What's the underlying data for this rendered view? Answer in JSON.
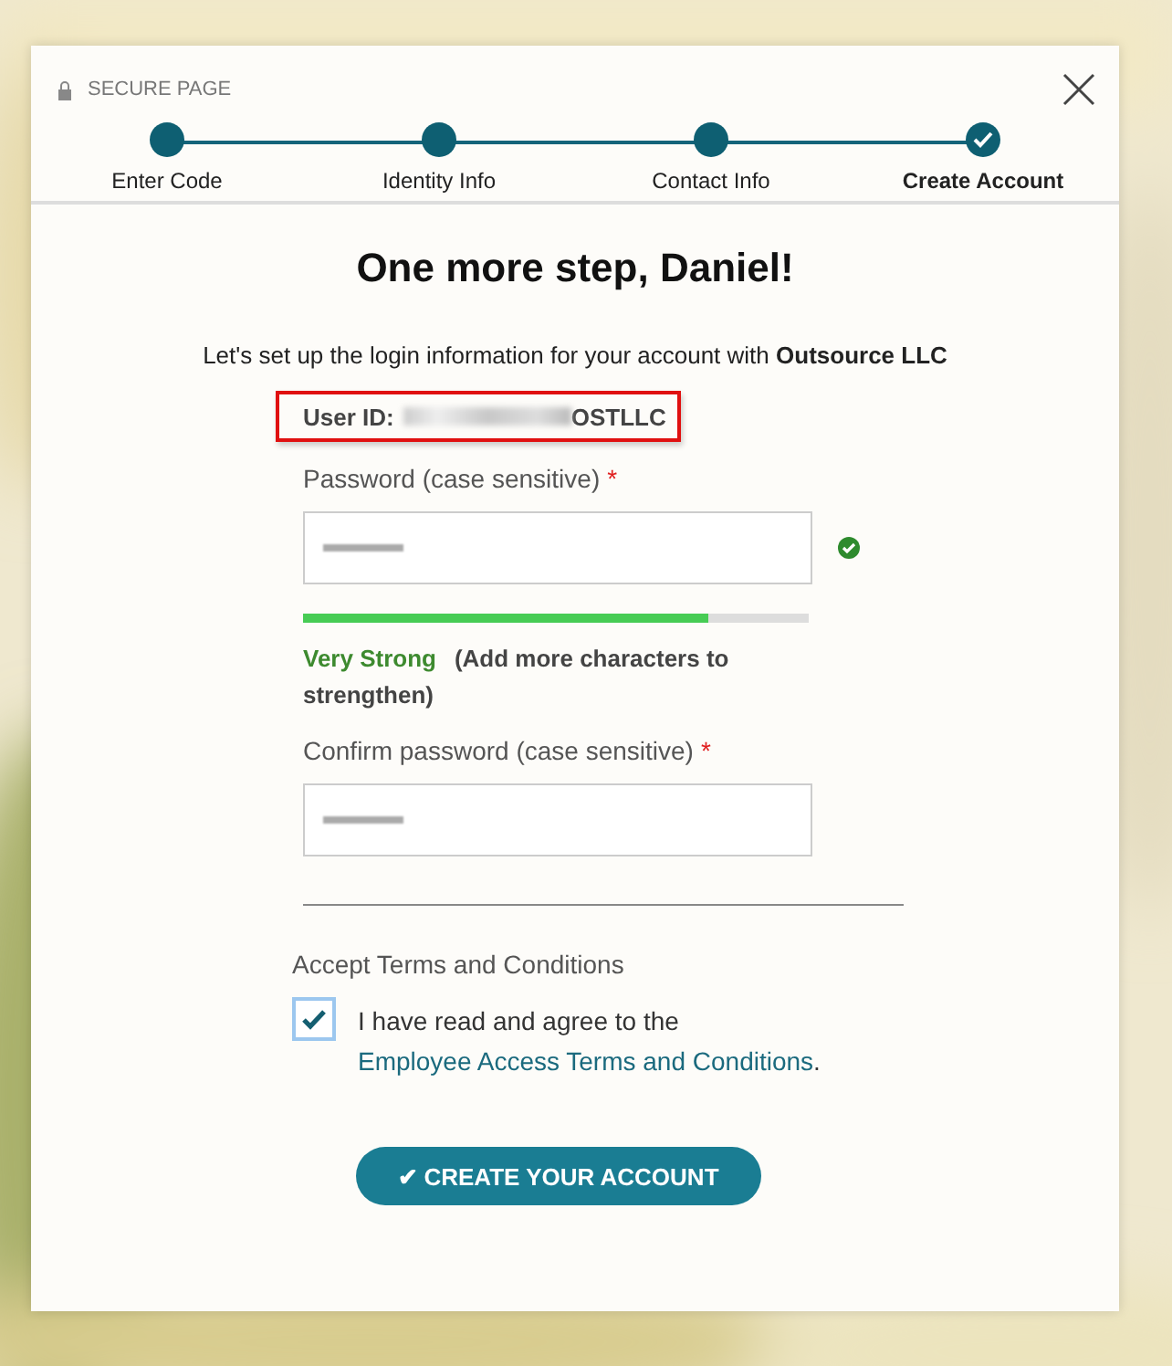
{
  "header": {
    "secure_label": "SECURE PAGE"
  },
  "steps": [
    {
      "label": "Enter Code",
      "selected": false
    },
    {
      "label": "Identity Info",
      "selected": false
    },
    {
      "label": "Contact Info",
      "selected": false
    },
    {
      "label": "Create Account",
      "selected": true
    }
  ],
  "title": "One more step, Daniel!",
  "intro": "Let's set up the login information for your account with **Outsource LLC**",
  "user_id": {
    "label": "User ID:",
    "visible_value": "OSTLLC",
    "redacted": true
  },
  "password": {
    "label": "Password (case sensitive)",
    "required": "*",
    "masked": true,
    "valid": true,
    "strength": {
      "level": 0.8,
      "label": "Very Strong",
      "hint": "(Add more characters to strengthen)"
    }
  },
  "confirm_password": {
    "label": "Confirm password (case sensitive)",
    "required": "*",
    "masked": true
  },
  "terms": {
    "heading": "Accept Terms and Conditions",
    "checked": true,
    "text": "I have read and agree to the",
    "link": "Employee Access Terms and Conditions",
    "end": "."
  },
  "submit": {
    "icon": "✔",
    "label": "CREATE YOUR ACCOUNT"
  }
}
